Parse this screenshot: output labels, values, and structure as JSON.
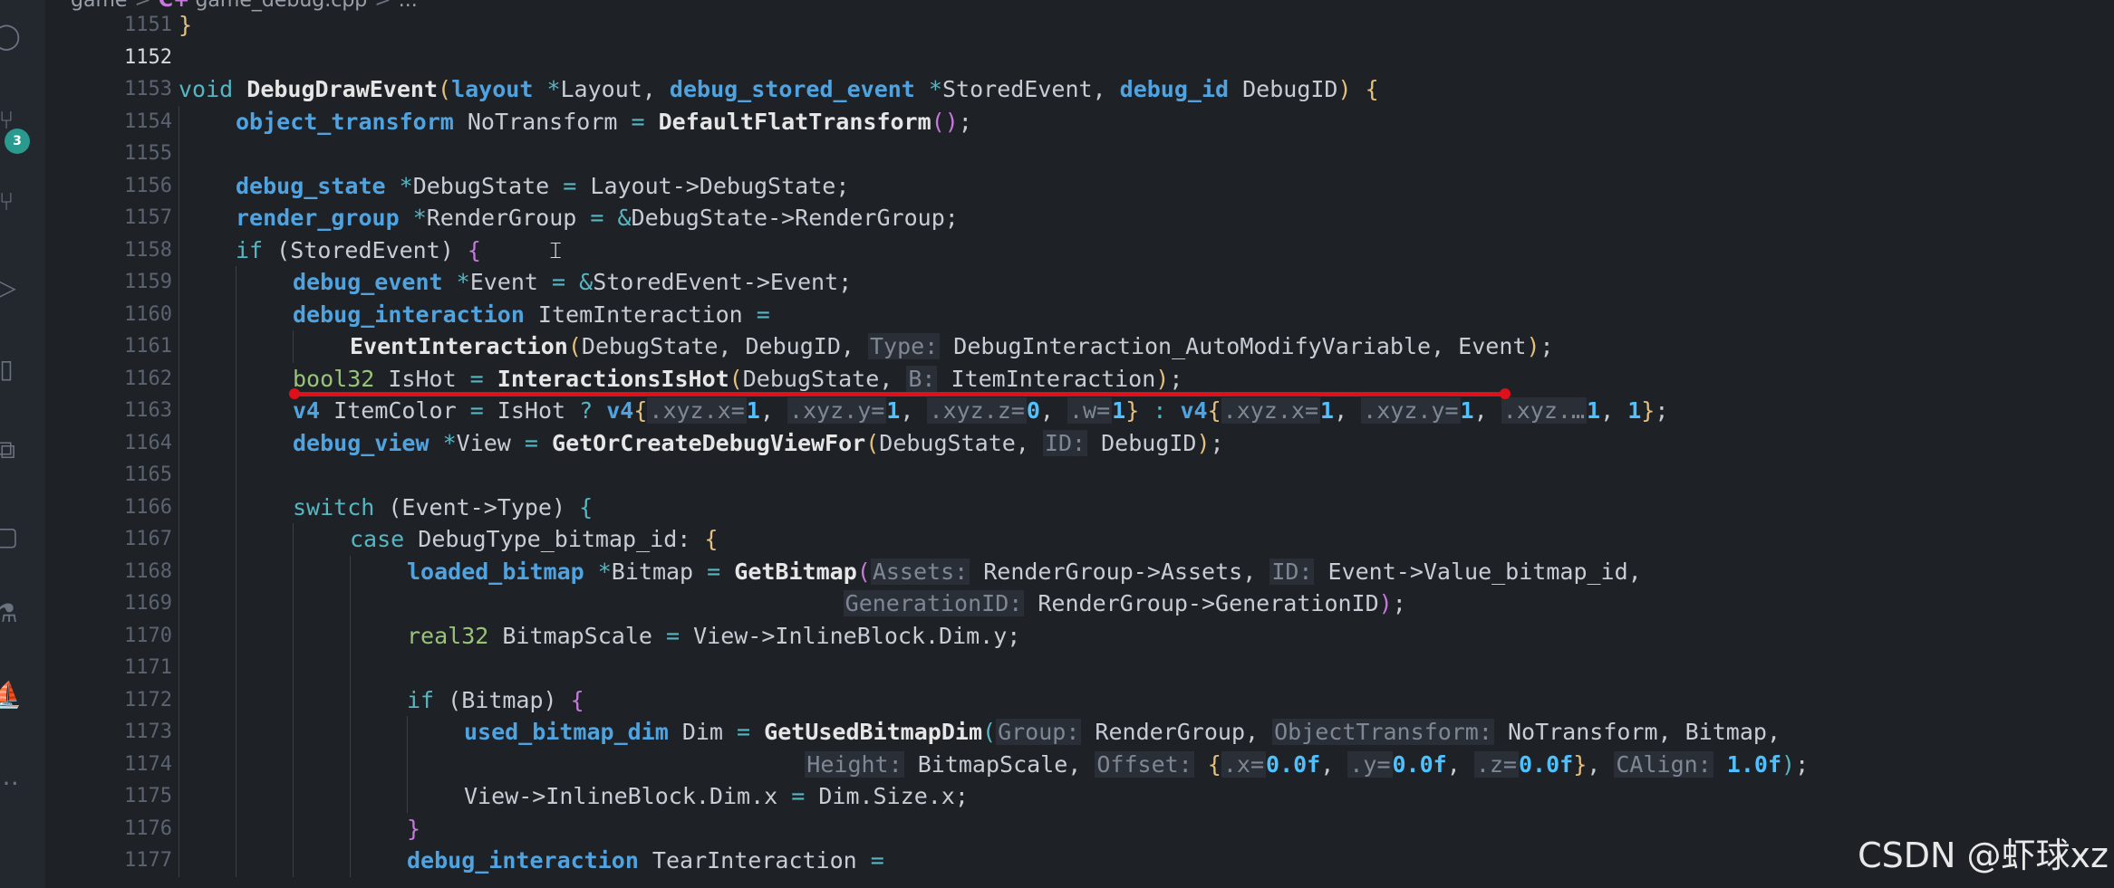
{
  "breadcrumb": {
    "folder": "game",
    "file_icon": "C+",
    "file": "game_debug.cpp",
    "trail": "..."
  },
  "activity_bar": {
    "source_control_badge": "3"
  },
  "colors": {
    "background": "#1e2227",
    "type": "#4fa3e0",
    "annotation_red": "#e0101a",
    "badge": "#2a9a8f"
  },
  "watermark": "CSDN @虾球xz",
  "lines": [
    {
      "num": "1151",
      "indent": 0,
      "tokens": [
        {
          "c": "p",
          "t": "}"
        }
      ]
    },
    {
      "num": "1152",
      "indent": 0,
      "active": true,
      "tokens": []
    },
    {
      "num": "1153",
      "indent": 0,
      "tokens": [
        {
          "c": "kw",
          "t": "void"
        },
        {
          "c": "",
          "t": " "
        },
        {
          "c": "f",
          "t": "DebugDrawEvent"
        },
        {
          "c": "p",
          "t": "("
        },
        {
          "c": "t",
          "t": "layout"
        },
        {
          "c": "",
          "t": " "
        },
        {
          "c": "op",
          "t": "*"
        },
        {
          "c": "",
          "t": "Layout, "
        },
        {
          "c": "t",
          "t": "debug_stored_event"
        },
        {
          "c": "",
          "t": " "
        },
        {
          "c": "op",
          "t": "*"
        },
        {
          "c": "",
          "t": "StoredEvent, "
        },
        {
          "c": "t",
          "t": "debug_id"
        },
        {
          "c": "",
          "t": " DebugID"
        },
        {
          "c": "p",
          "t": ")"
        },
        {
          "c": "",
          "t": " "
        },
        {
          "c": "p",
          "t": "{"
        }
      ]
    },
    {
      "num": "1154",
      "indent": 1,
      "tokens": [
        {
          "c": "t",
          "t": "object_transform"
        },
        {
          "c": "",
          "t": " NoTransform "
        },
        {
          "c": "op",
          "t": "="
        },
        {
          "c": "",
          "t": " "
        },
        {
          "c": "f",
          "t": "DefaultFlatTransform"
        },
        {
          "c": "pm",
          "t": "()"
        },
        {
          "c": "",
          "t": ";"
        }
      ]
    },
    {
      "num": "1155",
      "indent": 1,
      "tokens": []
    },
    {
      "num": "1156",
      "indent": 1,
      "tokens": [
        {
          "c": "t",
          "t": "debug_state"
        },
        {
          "c": "",
          "t": " "
        },
        {
          "c": "op",
          "t": "*"
        },
        {
          "c": "",
          "t": "DebugState "
        },
        {
          "c": "op",
          "t": "="
        },
        {
          "c": "",
          "t": " Layout->DebugState;"
        }
      ]
    },
    {
      "num": "1157",
      "indent": 1,
      "tokens": [
        {
          "c": "t",
          "t": "render_group"
        },
        {
          "c": "",
          "t": " "
        },
        {
          "c": "op",
          "t": "*"
        },
        {
          "c": "",
          "t": "RenderGroup "
        },
        {
          "c": "op",
          "t": "="
        },
        {
          "c": "",
          "t": " "
        },
        {
          "c": "op",
          "t": "&"
        },
        {
          "c": "",
          "t": "DebugState->RenderGroup;"
        }
      ]
    },
    {
      "num": "1158",
      "indent": 1,
      "tokens": [
        {
          "c": "kw",
          "t": "if"
        },
        {
          "c": "",
          "t": " (StoredEvent) "
        },
        {
          "c": "pm",
          "t": "{"
        }
      ]
    },
    {
      "num": "1159",
      "indent": 2,
      "tokens": [
        {
          "c": "t",
          "t": "debug_event"
        },
        {
          "c": "",
          "t": " "
        },
        {
          "c": "op",
          "t": "*"
        },
        {
          "c": "",
          "t": "Event "
        },
        {
          "c": "op",
          "t": "="
        },
        {
          "c": "",
          "t": " "
        },
        {
          "c": "op",
          "t": "&"
        },
        {
          "c": "",
          "t": "StoredEvent->Event;"
        }
      ]
    },
    {
      "num": "1160",
      "indent": 2,
      "tokens": [
        {
          "c": "t",
          "t": "debug_interaction"
        },
        {
          "c": "",
          "t": " ItemInteraction "
        },
        {
          "c": "op",
          "t": "="
        }
      ]
    },
    {
      "num": "1161",
      "indent": 3,
      "tokens": [
        {
          "c": "f",
          "t": "EventInteraction"
        },
        {
          "c": "p",
          "t": "("
        },
        {
          "c": "",
          "t": "DebugState, DebugID, "
        },
        {
          "c": "hint",
          "t": "Type:"
        },
        {
          "c": "",
          "t": " DebugInteraction_AutoModifyVariable, Event"
        },
        {
          "c": "p",
          "t": ")"
        },
        {
          "c": "",
          "t": ";"
        }
      ]
    },
    {
      "num": "1162",
      "indent": 2,
      "tokens": [
        {
          "c": "tl",
          "t": "bool32"
        },
        {
          "c": "",
          "t": " IsHot "
        },
        {
          "c": "op",
          "t": "="
        },
        {
          "c": "",
          "t": " "
        },
        {
          "c": "f",
          "t": "InteractionsIsHot"
        },
        {
          "c": "p",
          "t": "("
        },
        {
          "c": "",
          "t": "DebugState, "
        },
        {
          "c": "hint",
          "t": "B:"
        },
        {
          "c": "",
          "t": " ItemInteraction"
        },
        {
          "c": "p",
          "t": ")"
        },
        {
          "c": "",
          "t": ";"
        }
      ]
    },
    {
      "num": "1163",
      "indent": 2,
      "tokens": [
        {
          "c": "t",
          "t": "v4"
        },
        {
          "c": "",
          "t": " ItemColor "
        },
        {
          "c": "op",
          "t": "="
        },
        {
          "c": "",
          "t": " IsHot "
        },
        {
          "c": "op",
          "t": "?"
        },
        {
          "c": "",
          "t": " "
        },
        {
          "c": "t",
          "t": "v4"
        },
        {
          "c": "p",
          "t": "{"
        },
        {
          "c": "hint",
          "t": ".xyz.x="
        },
        {
          "c": "n",
          "t": "1"
        },
        {
          "c": "",
          "t": ", "
        },
        {
          "c": "hint",
          "t": ".xyz.y="
        },
        {
          "c": "n",
          "t": "1"
        },
        {
          "c": "",
          "t": ", "
        },
        {
          "c": "hint",
          "t": ".xyz.z="
        },
        {
          "c": "n",
          "t": "0"
        },
        {
          "c": "",
          "t": ", "
        },
        {
          "c": "hint",
          "t": ".w="
        },
        {
          "c": "n",
          "t": "1"
        },
        {
          "c": "p",
          "t": "}"
        },
        {
          "c": "",
          "t": " "
        },
        {
          "c": "op",
          "t": ":"
        },
        {
          "c": "",
          "t": " "
        },
        {
          "c": "t",
          "t": "v4"
        },
        {
          "c": "p",
          "t": "{"
        },
        {
          "c": "hint",
          "t": ".xyz.x="
        },
        {
          "c": "n",
          "t": "1"
        },
        {
          "c": "",
          "t": ", "
        },
        {
          "c": "hint",
          "t": ".xyz.y="
        },
        {
          "c": "n",
          "t": "1"
        },
        {
          "c": "",
          "t": ", "
        },
        {
          "c": "hint",
          "t": ".xyz.…"
        },
        {
          "c": "n",
          "t": "1"
        },
        {
          "c": "",
          "t": ", "
        },
        {
          "c": "n",
          "t": "1"
        },
        {
          "c": "p",
          "t": "}"
        },
        {
          "c": "",
          "t": ";"
        }
      ]
    },
    {
      "num": "1164",
      "indent": 2,
      "tokens": [
        {
          "c": "t",
          "t": "debug_view"
        },
        {
          "c": "",
          "t": " "
        },
        {
          "c": "op",
          "t": "*"
        },
        {
          "c": "",
          "t": "View "
        },
        {
          "c": "op",
          "t": "="
        },
        {
          "c": "",
          "t": " "
        },
        {
          "c": "f",
          "t": "GetOrCreateDebugViewFor"
        },
        {
          "c": "p",
          "t": "("
        },
        {
          "c": "",
          "t": "DebugState, "
        },
        {
          "c": "hint",
          "t": "ID:"
        },
        {
          "c": "",
          "t": " DebugID"
        },
        {
          "c": "p",
          "t": ")"
        },
        {
          "c": "",
          "t": ";"
        }
      ]
    },
    {
      "num": "1165",
      "indent": 2,
      "tokens": []
    },
    {
      "num": "1166",
      "indent": 2,
      "tokens": [
        {
          "c": "kw",
          "t": "switch"
        },
        {
          "c": "",
          "t": " (Event->Type) "
        },
        {
          "c": "op",
          "t": "{"
        }
      ]
    },
    {
      "num": "1167",
      "indent": 3,
      "tokens": [
        {
          "c": "kw",
          "t": "case"
        },
        {
          "c": "",
          "t": " DebugType_bitmap_id: "
        },
        {
          "c": "p",
          "t": "{"
        }
      ]
    },
    {
      "num": "1168",
      "indent": 4,
      "tokens": [
        {
          "c": "t",
          "t": "loaded_bitmap"
        },
        {
          "c": "",
          "t": " "
        },
        {
          "c": "op",
          "t": "*"
        },
        {
          "c": "",
          "t": "Bitmap "
        },
        {
          "c": "op",
          "t": "="
        },
        {
          "c": "",
          "t": " "
        },
        {
          "c": "f",
          "t": "GetBitmap"
        },
        {
          "c": "pm",
          "t": "("
        },
        {
          "c": "hint",
          "t": "Assets:"
        },
        {
          "c": "",
          "t": " RenderGroup->Assets, "
        },
        {
          "c": "hint",
          "t": "ID:"
        },
        {
          "c": "",
          "t": " Event->Value_bitmap_id,"
        }
      ]
    },
    {
      "num": "1169",
      "indent": 4,
      "tokens": [
        {
          "c": "",
          "t": "                                "
        },
        {
          "c": "hint",
          "t": "GenerationID:"
        },
        {
          "c": "",
          "t": " RenderGroup->GenerationID"
        },
        {
          "c": "pm",
          "t": ")"
        },
        {
          "c": "",
          "t": ";"
        }
      ]
    },
    {
      "num": "1170",
      "indent": 4,
      "tokens": [
        {
          "c": "tl",
          "t": "real32"
        },
        {
          "c": "",
          "t": " BitmapScale "
        },
        {
          "c": "op",
          "t": "="
        },
        {
          "c": "",
          "t": " View->InlineBlock.Dim.y;"
        }
      ]
    },
    {
      "num": "1171",
      "indent": 4,
      "tokens": []
    },
    {
      "num": "1172",
      "indent": 4,
      "tokens": [
        {
          "c": "kw",
          "t": "if"
        },
        {
          "c": "",
          "t": " (Bitmap) "
        },
        {
          "c": "pm",
          "t": "{"
        }
      ]
    },
    {
      "num": "1173",
      "indent": 5,
      "tokens": [
        {
          "c": "t",
          "t": "used_bitmap_dim"
        },
        {
          "c": "",
          "t": " Dim "
        },
        {
          "c": "op",
          "t": "="
        },
        {
          "c": "",
          "t": " "
        },
        {
          "c": "f",
          "t": "GetUsedBitmapDim"
        },
        {
          "c": "op",
          "t": "("
        },
        {
          "c": "hint",
          "t": "Group:"
        },
        {
          "c": "",
          "t": " RenderGroup, "
        },
        {
          "c": "hint",
          "t": "ObjectTransform:"
        },
        {
          "c": "",
          "t": " NoTransform, Bitmap,"
        }
      ]
    },
    {
      "num": "1174",
      "indent": 5,
      "tokens": [
        {
          "c": "",
          "t": "                         "
        },
        {
          "c": "hint",
          "t": "Height:"
        },
        {
          "c": "",
          "t": " BitmapScale, "
        },
        {
          "c": "hint",
          "t": "Offset:"
        },
        {
          "c": "",
          "t": " "
        },
        {
          "c": "p",
          "t": "{"
        },
        {
          "c": "hint",
          "t": ".x="
        },
        {
          "c": "n",
          "t": "0.0f"
        },
        {
          "c": "",
          "t": ", "
        },
        {
          "c": "hint",
          "t": ".y="
        },
        {
          "c": "n",
          "t": "0.0f"
        },
        {
          "c": "",
          "t": ", "
        },
        {
          "c": "hint",
          "t": ".z="
        },
        {
          "c": "n",
          "t": "0.0f"
        },
        {
          "c": "p",
          "t": "}"
        },
        {
          "c": "",
          "t": ", "
        },
        {
          "c": "hint",
          "t": "CAlign:"
        },
        {
          "c": "",
          "t": " "
        },
        {
          "c": "n",
          "t": "1.0f"
        },
        {
          "c": "op",
          "t": ")"
        },
        {
          "c": "",
          "t": ";"
        }
      ]
    },
    {
      "num": "1175",
      "indent": 5,
      "tokens": [
        {
          "c": "",
          "t": "View->InlineBlock.Dim.x "
        },
        {
          "c": "op",
          "t": "="
        },
        {
          "c": "",
          "t": " Dim.Size.x;"
        }
      ]
    },
    {
      "num": "1176",
      "indent": 4,
      "tokens": [
        {
          "c": "pm",
          "t": "}"
        }
      ]
    },
    {
      "num": "1177",
      "indent": 4,
      "tokens": [
        {
          "c": "t",
          "t": "debug_interaction"
        },
        {
          "c": "",
          "t": " TearInteraction "
        },
        {
          "c": "op",
          "t": "="
        }
      ]
    }
  ]
}
